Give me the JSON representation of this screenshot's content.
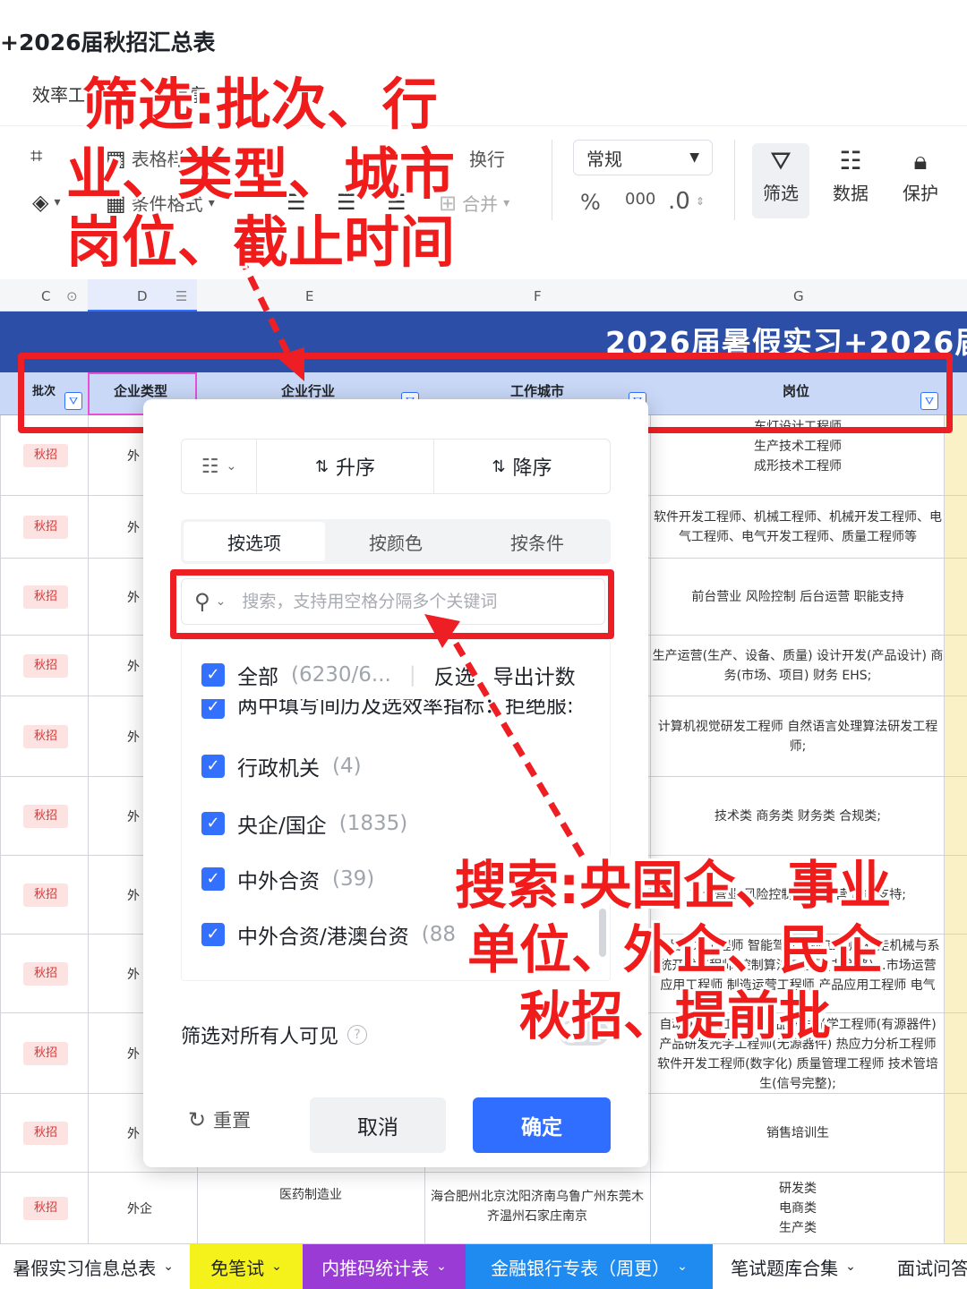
{
  "doc": {
    "title": "+2026届秋招汇总表",
    "menu_left": "效率工",
    "menu_right": "专享"
  },
  "toolbar": {
    "table_style": "表格样",
    "cond_format": "条件格式",
    "wrap": "换行",
    "merge": "合并",
    "number_format": "常规",
    "percent": "%",
    "thousand": "000",
    "decimal": ".0",
    "filter": "筛选",
    "data": "数据",
    "protect": "保护"
  },
  "columns": [
    "C",
    "D",
    "E",
    "F",
    "G"
  ],
  "banner": "2026届暑假实习+2026届",
  "headers": {
    "batch": "批次",
    "company_type": "企业类型",
    "industry": "企业行业",
    "city": "工作城市",
    "position": "岗位"
  },
  "rows": [
    {
      "tag": "秋招",
      "type": "外",
      "position": "车灯设计工程师\n生产技术工程师\n成形技术工程师"
    },
    {
      "tag": "秋招",
      "type": "外",
      "position": "软件开发工程师、机械工程师、机械开发工程师、电气工程师、电气开发工程师、质量工程师等"
    },
    {
      "tag": "秋招",
      "type": "外",
      "position": "前台营业 风险控制 后台运营 职能支持"
    },
    {
      "tag": "秋招",
      "type": "外",
      "position": "生产运营(生产、设备、质量) 设计开发(产品设计) 商务(市场、项目) 财务 EHS;"
    },
    {
      "tag": "秋招",
      "type": "外",
      "position": "计算机视觉研发工程师 自然语言处理算法研发工程师;"
    },
    {
      "tag": "秋招",
      "type": "外",
      "position": "技术类 商务类 财务类 合规类;"
    },
    {
      "tag": "秋招",
      "type": "外",
      "position": "前台营业 风险控制 后台运营 职能支持;"
    },
    {
      "tag": "秋招",
      "type": "外",
      "position": "产品研发工程师 智能驾驶系统工程师 行走机械与系统开发工程师 控制算法工程师(非道路)…市场运营 应用工程师 制造运营工程师 产品应用工程师 电气"
    },
    {
      "tag": "秋招",
      "type": "外",
      "position": "自动化测试工程师 产品研发光学工程师(有源器件) 产品研发光学工程师(无源器件) 热应力分析工程师 软件开发工程师(数字化) 质量管理工程师 技术管培生(信号完整);"
    },
    {
      "tag": "秋招",
      "type": "外",
      "position": "销售培训生"
    },
    {
      "tag": "秋招",
      "type": "外企",
      "industry": "医药制造业",
      "city": "海合肥州北京沈阳济南乌鲁广州东莞木齐温州石家庄南京",
      "position": "研发类\n电商类\n生产类"
    }
  ],
  "popup": {
    "sort_asc": "升序",
    "sort_desc": "降序",
    "tab_by_option": "按选项",
    "tab_by_color": "按颜色",
    "tab_by_condition": "按条件",
    "search_placeholder": "搜索，支持用空格分隔多个关键词",
    "all_label": "全部",
    "all_count": "(6230/6...",
    "invert": "反选",
    "export_count": "导出计数",
    "partial_row": "两中填写间历及选效率指标：拒绝服:",
    "options": [
      {
        "label": "行政机关",
        "count": "(4)"
      },
      {
        "label": "央企/国企",
        "count": "(1835)"
      },
      {
        "label": "中外合资",
        "count": "(39)"
      },
      {
        "label": "中外合资/港澳台资",
        "count": "(88"
      }
    ],
    "visible_label": "筛选对所有人可见",
    "reset": "重置",
    "cancel": "取消",
    "confirm": "确定"
  },
  "annotations": {
    "top_line1": "筛选:批次、行",
    "top_line2": "业、类型、城市",
    "top_line3": "岗位、截止时间",
    "bottom_line1": "搜索:央国企、事业",
    "bottom_line2": "单位、外企、民企",
    "bottom_line3": "秋招、提前批",
    "color": "#ee1f24"
  },
  "sheet_tabs": [
    {
      "label": "暑假实习信息总表",
      "bg": "#ffffff",
      "fg": "#1f2329"
    },
    {
      "label": "免笔试",
      "bg": "#f5f21b",
      "fg": "#1f2329"
    },
    {
      "label": "内推码统计表",
      "bg": "#9b3bd6",
      "fg": "#ffffff"
    },
    {
      "label": "金融银行专表（周更）",
      "bg": "#1f8bf0",
      "fg": "#ffffff"
    },
    {
      "label": "笔试题库合集",
      "bg": "#ffffff",
      "fg": "#1f2329"
    },
    {
      "label": "面试问答",
      "bg": "#ffffff",
      "fg": "#1f2329"
    }
  ]
}
